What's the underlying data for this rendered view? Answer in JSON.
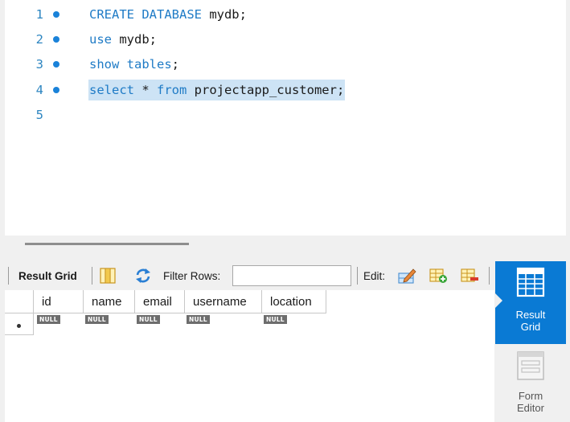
{
  "editor": {
    "lines": [
      {
        "number": "1",
        "breakpoint": true,
        "parts": [
          [
            "kw",
            "CREATE DATABASE"
          ],
          [
            "tx",
            " mydb;"
          ]
        ]
      },
      {
        "number": "2",
        "breakpoint": true,
        "parts": [
          [
            "kw",
            "use"
          ],
          [
            "tx",
            " mydb;"
          ]
        ]
      },
      {
        "number": "3",
        "breakpoint": true,
        "parts": [
          [
            "kw",
            "show tables"
          ],
          [
            "tx",
            ";"
          ]
        ]
      },
      {
        "number": "4",
        "breakpoint": true,
        "highlighted": true,
        "parts": [
          [
            "kw",
            "select"
          ],
          [
            "tx",
            " * "
          ],
          [
            "kw",
            "from"
          ],
          [
            "tx",
            " projectapp_customer;"
          ]
        ]
      },
      {
        "number": "5",
        "breakpoint": false,
        "parts": []
      }
    ]
  },
  "toolbar": {
    "result_grid_label": "Result Grid",
    "filter_rows_label": "Filter Rows:",
    "filter_value": "",
    "edit_label": "Edit:"
  },
  "grid": {
    "columns": [
      "id",
      "name",
      "email",
      "username",
      "location"
    ],
    "row_cells": [
      "NULL",
      "NULL",
      "NULL",
      "NULL",
      "NULL"
    ]
  },
  "side_panel": {
    "result_grid": {
      "line1": "Result",
      "line2": "Grid"
    },
    "form_editor": {
      "line1": "Form",
      "line2": "Editor"
    }
  },
  "colors": {
    "keyword": "#1f7bc6",
    "line_number": "#2e86c1",
    "selection": "#cde3f5",
    "active_panel": "#0a7ad4"
  }
}
